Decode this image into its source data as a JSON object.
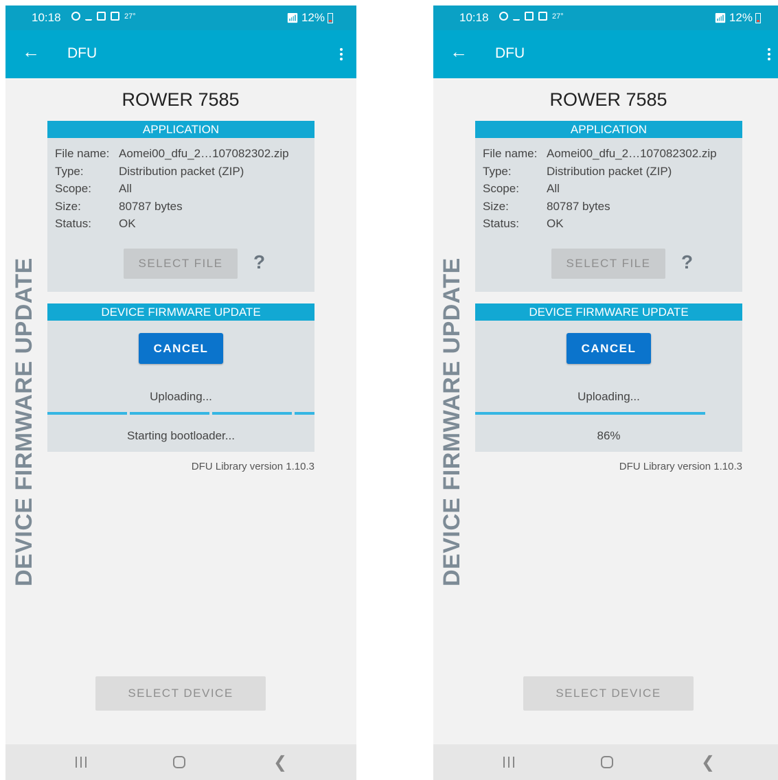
{
  "screens": [
    {
      "status_bar": {
        "time": "10:18",
        "temperature": "27°",
        "battery": "12%"
      },
      "app_bar": {
        "title": "DFU"
      },
      "side_label": "DEVICE FIRMWARE UPDATE",
      "device_name": "ROWER 7585",
      "application": {
        "header": "APPLICATION",
        "rows": [
          {
            "key": "File name:",
            "value": "Aomei00_dfu_2…107082302.zip"
          },
          {
            "key": "Type:",
            "value": "Distribution packet (ZIP)"
          },
          {
            "key": "Scope:",
            "value": "All"
          },
          {
            "key": "Size:",
            "value": "80787 bytes"
          },
          {
            "key": "Status:",
            "value": "OK"
          }
        ],
        "select_file_label": "SELECT FILE",
        "help_label": "?"
      },
      "dfu": {
        "header": "DEVICE FIRMWARE UPDATE",
        "cancel_label": "CANCEL",
        "uploading_text": "Uploading...",
        "progress_mode": "indeterminate",
        "status_text": "Starting bootloader..."
      },
      "library_version": "DFU Library version 1.10.3",
      "select_device_label": "SELECT DEVICE"
    },
    {
      "status_bar": {
        "time": "10:18",
        "temperature": "27°",
        "battery": "12%"
      },
      "app_bar": {
        "title": "DFU"
      },
      "side_label": "DEVICE FIRMWARE UPDATE",
      "device_name": "ROWER 7585",
      "application": {
        "header": "APPLICATION",
        "rows": [
          {
            "key": "File name:",
            "value": "Aomei00_dfu_2…107082302.zip"
          },
          {
            "key": "Type:",
            "value": "Distribution packet (ZIP)"
          },
          {
            "key": "Scope:",
            "value": "All"
          },
          {
            "key": "Size:",
            "value": "80787 bytes"
          },
          {
            "key": "Status:",
            "value": "OK"
          }
        ],
        "select_file_label": "SELECT FILE",
        "help_label": "?"
      },
      "dfu": {
        "header": "DEVICE FIRMWARE UPDATE",
        "cancel_label": "CANCEL",
        "uploading_text": "Uploading...",
        "progress_mode": "determinate",
        "progress_percent": 86,
        "status_text": "86%"
      },
      "library_version": "DFU Library version 1.10.3",
      "select_device_label": "SELECT DEVICE"
    }
  ],
  "colors": {
    "status_bar": "#0aa1c5",
    "app_bar": "#00a8cf",
    "panel_header": "#12a8d3",
    "panel_bg": "#dce1e4",
    "cancel_button": "#0b74cc",
    "progress": "#35b6e3"
  }
}
